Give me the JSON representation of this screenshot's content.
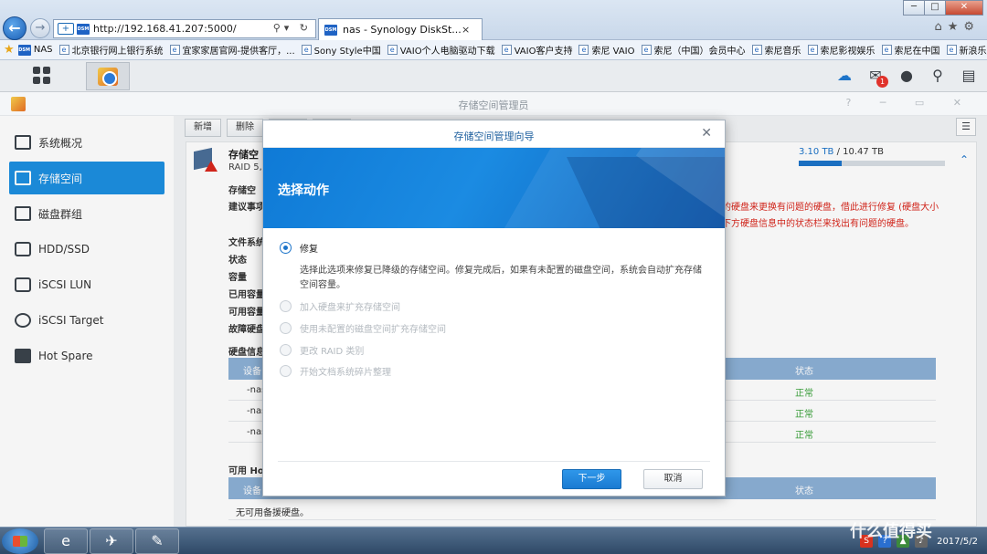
{
  "browser": {
    "url": "http://192.168.41.207:5000/",
    "tab_title": "nas - Synology DiskSt...",
    "tab_close": "×",
    "back_icon": "arrow-left-icon",
    "forward_icon": "arrow-right-icon",
    "window_buttons": [
      "─",
      "□",
      "✕"
    ]
  },
  "favorites": [
    "NAS",
    "北京银行网上银行系统",
    "宜家家居官网-提供客厅，...",
    "Sony Style中国",
    "VAIO个人电脑驱动下载",
    "VAIO客户支持",
    "索尼 VAIO",
    "索尼（中国）会员中心",
    "索尼音乐",
    "索尼影视娱乐",
    "索尼在中国",
    "新浪乐库"
  ],
  "dsm": {
    "notification_count": "1"
  },
  "app": {
    "title": "存储空间管理员"
  },
  "sidebar": {
    "items": [
      {
        "label": "系统概况",
        "icon": "overview-icon"
      },
      {
        "label": "存储空间",
        "icon": "storage-icon"
      },
      {
        "label": "磁盘群组",
        "icon": "disk-group-icon"
      },
      {
        "label": "HDD/SSD",
        "icon": "hdd-icon"
      },
      {
        "label": "iSCSI LUN",
        "icon": "lun-icon"
      },
      {
        "label": "iSCSI Target",
        "icon": "target-icon"
      },
      {
        "label": "Hot Spare",
        "icon": "hot-spare-icon"
      }
    ],
    "active_index": 1
  },
  "toolbar": {
    "new": "新增",
    "delete": "删除"
  },
  "volume": {
    "name": "存储空",
    "raid": "RAID 5,",
    "capacity_used": "3.10 TB",
    "capacity_sep": " / ",
    "capacity_total": "10.47 TB",
    "usage_fraction": 0.296,
    "collapse": "⌃",
    "labels": {
      "status_group": "存储空",
      "suggestion": "建议事项",
      "filesystem": "文件系统",
      "status": "状态",
      "capacity": "容量",
      "used": "已用容量",
      "available": "可用容量",
      "fault": "故障硬盘",
      "disk_info": "硬盘信息",
      "hot_spare": "可用 Hot"
    },
    "warning_line1": "的硬盘来更换有问题的硬盘，借此进行修复 (硬盘大小",
    "warning_line2": "下方硬盘信息中的状态栏来找出有问题的硬盘。"
  },
  "disk_table": {
    "headers": {
      "device": "设备",
      "status": "状态"
    },
    "rows": [
      {
        "device": "-nas",
        "status": "正常"
      },
      {
        "device": "-nas",
        "status": "正常"
      },
      {
        "device": "-nas",
        "status": "正常"
      }
    ]
  },
  "spare_table": {
    "headers": {
      "device": "设备",
      "status": "状态"
    },
    "empty": "无可用备援硬盘。"
  },
  "dialog": {
    "title": "存储空间管理向导",
    "close": "✕",
    "heading": "选择动作",
    "options": [
      {
        "label": "修复",
        "selected": true,
        "enabled": true
      },
      {
        "label": "加入硬盘来扩充存储空间",
        "selected": false,
        "enabled": false
      },
      {
        "label": "使用未配置的磁盘空间扩充存储空间",
        "selected": false,
        "enabled": false
      },
      {
        "label": "更改 RAID 类别",
        "selected": false,
        "enabled": false
      },
      {
        "label": "开始文档系统碎片整理",
        "selected": false,
        "enabled": false
      }
    ],
    "repair_description": "选择此选项来修复已降级的存储空间。修复完成后，如果有未配置的磁盘空间，系统会自动扩充存储空间容量。",
    "next": "下一步",
    "cancel": "取消"
  },
  "taskbar": {
    "clock_date": "2017/5/2",
    "watermark": "什么值得买"
  },
  "colors": {
    "accent": "#1d8fe0",
    "ok": "#3aa23a",
    "warning": "#d9261c",
    "table_header": "#8cb0d6"
  }
}
